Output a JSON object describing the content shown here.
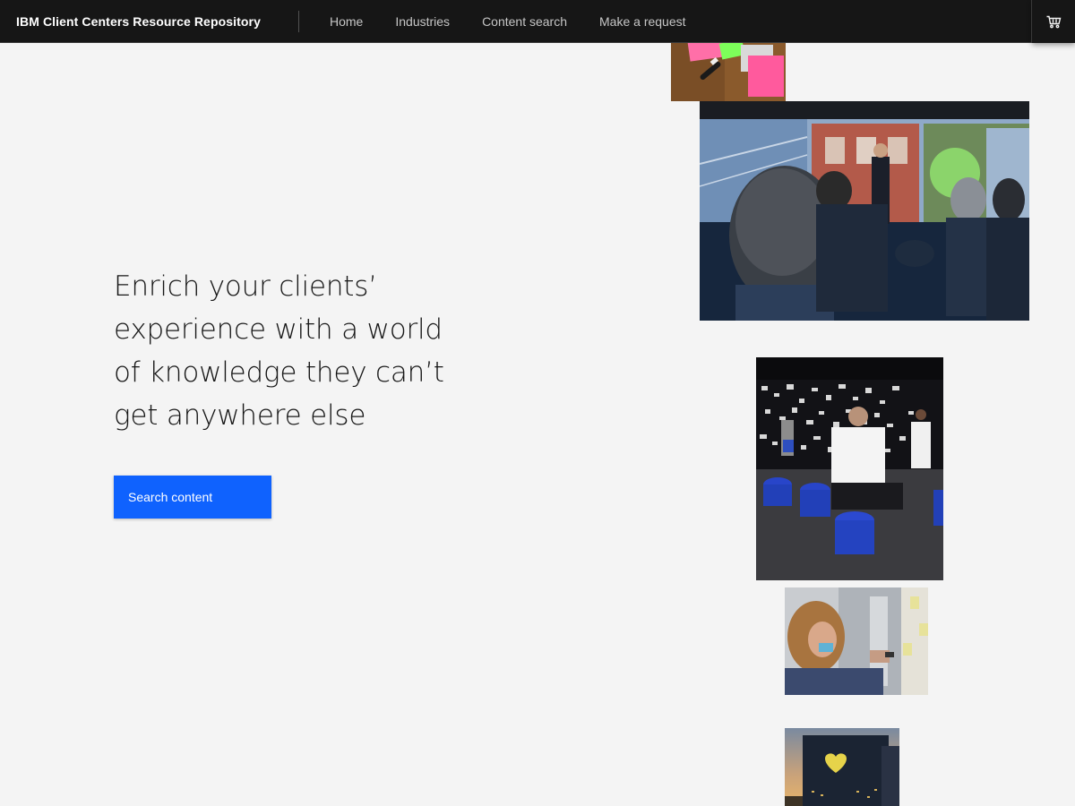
{
  "header": {
    "brand": "IBM Client Centers Resource Repository",
    "nav": [
      {
        "label": "Home"
      },
      {
        "label": "Industries"
      },
      {
        "label": "Content search"
      },
      {
        "label": "Make a request"
      }
    ],
    "cart_icon": "shopping-cart-icon"
  },
  "hero": {
    "heading": "Enrich your clients’ experience with a world of knowledge they can’t get anywhere else",
    "cta_label": "Search content"
  },
  "colors": {
    "header_bg": "#161616",
    "page_bg": "#f4f4f4",
    "primary": "#0f62fe"
  }
}
